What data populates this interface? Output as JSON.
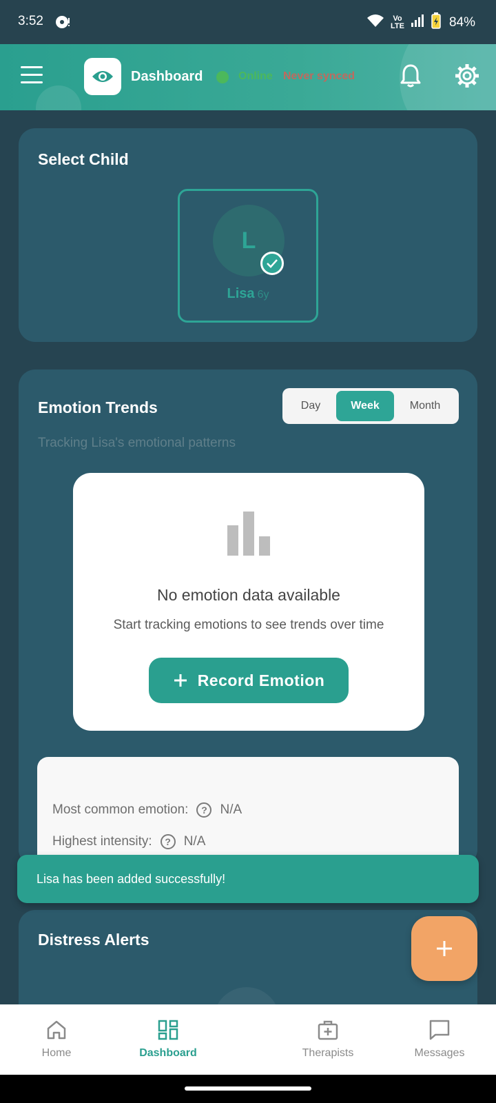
{
  "status_bar": {
    "time": "3:52",
    "network": "Vo LTE",
    "battery": "84%"
  },
  "header": {
    "title": "Dashboard",
    "connection_status": "Online",
    "sync_status": "Never synced"
  },
  "select_child": {
    "title": "Select Child",
    "children": [
      {
        "initial": "L",
        "name": "Lisa",
        "age": "6y",
        "selected": true
      }
    ]
  },
  "emotion_trends": {
    "title": "Emotion Trends",
    "subtitle": "Tracking Lisa's emotional patterns",
    "periods": [
      "Day",
      "Week",
      "Month"
    ],
    "selected_period": "Week",
    "empty_state": {
      "title": "No emotion data available",
      "message": "Start tracking emotions to see trends over time",
      "button_label": "Record Emotion"
    },
    "stats": [
      {
        "label": "Most common emotion:",
        "value": "N/A"
      },
      {
        "label": "Highest intensity:",
        "value": "N/A"
      }
    ]
  },
  "toast": {
    "message": "Lisa has been added successfully!"
  },
  "distress_alerts": {
    "title": "Distress Alerts"
  },
  "bottom_nav": {
    "items": [
      {
        "label": "Home",
        "icon": "home-icon"
      },
      {
        "label": "Dashboard",
        "icon": "dashboard-icon",
        "active": true
      },
      {
        "label": "Therapists",
        "icon": "medical-kit-icon"
      },
      {
        "label": "Messages",
        "icon": "chat-icon"
      }
    ]
  },
  "colors": {
    "background": "#264451",
    "card": "#2c5a6b",
    "accent": "#2a9f8f",
    "fab": "#f2a466",
    "online": "#4cb85b",
    "sync_warning": "#c06a5e"
  }
}
